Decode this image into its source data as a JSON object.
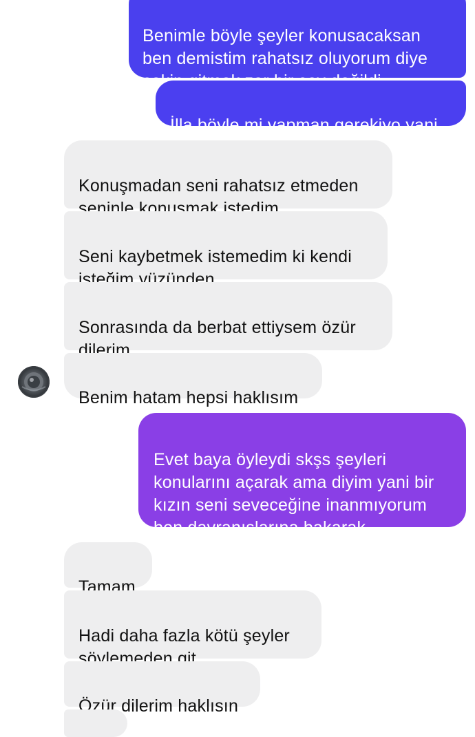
{
  "conversation": {
    "messages": [
      {
        "direction": "sent",
        "text": "Benimle böyle şeyler konusacaksan\nben demistim rahatsız oluyorum diye\nçekip gitmek zor bir şey değildi",
        "color": "#4a40ee"
      },
      {
        "direction": "sent",
        "text": "İlla böyle mi yapman gerekiyo yani",
        "color": "#4b3ff0"
      },
      {
        "direction": "received",
        "text": "Konuşmadan seni rahatsız etmeden\nseninle konuşmak istedim"
      },
      {
        "direction": "received",
        "text": "Seni kaybetmek istemedim ki kendi\nisteğim yüzünden"
      },
      {
        "direction": "received",
        "text": "Sonrasında da berbat ettiysem özür\ndilerim"
      },
      {
        "direction": "received",
        "text": "Benim hatam hepsi haklısım"
      },
      {
        "direction": "sent",
        "text": "Evet baya öyleydi skşs şeyleri\nkonularını açarak ama diyim yani bir\nkızın seni seveceğine inanmıyorum\nben davranışlarına bakarak",
        "color": "#8a3fe6"
      },
      {
        "direction": "received",
        "text": "Tamam"
      },
      {
        "direction": "received",
        "text": "Hadi daha fazla kötü şeyler\nsöylemeden git"
      },
      {
        "direction": "received",
        "text": "Özür dilerim haklısın"
      }
    ]
  },
  "colors": {
    "sent_blue": "#4a40ee",
    "sent_purple": "#8a3fe6",
    "received_bg": "#eeeeef"
  }
}
